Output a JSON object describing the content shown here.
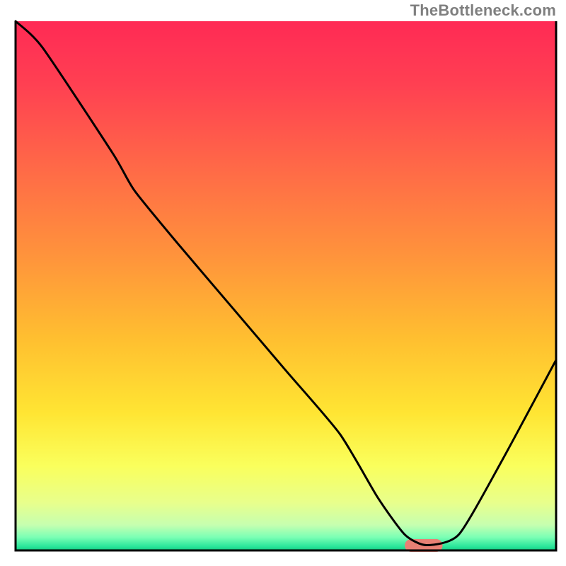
{
  "attribution": "TheBottleneck.com",
  "chart_data": {
    "type": "line",
    "title": "",
    "xlabel": "",
    "ylabel": "",
    "xlim": [
      0,
      100
    ],
    "ylim": [
      0,
      100
    ],
    "grid": false,
    "series": [
      {
        "name": "bottleneck-curve",
        "x": [
          0,
          5,
          18,
          22,
          30,
          40,
          50,
          60,
          67,
          72,
          76,
          82,
          90,
          100
        ],
        "values": [
          100,
          95,
          75,
          68,
          58,
          46,
          34,
          22,
          10,
          3,
          1,
          3,
          17,
          36
        ]
      }
    ],
    "optimal_marker": {
      "x_start": 72,
      "x_end": 79,
      "color": "#e98074",
      "thickness": 1.2
    },
    "gradient_stops": [
      {
        "offset": 0.0,
        "color": "#ff2a55"
      },
      {
        "offset": 0.12,
        "color": "#ff4052"
      },
      {
        "offset": 0.28,
        "color": "#ff6a47"
      },
      {
        "offset": 0.45,
        "color": "#ff953b"
      },
      {
        "offset": 0.6,
        "color": "#ffbf30"
      },
      {
        "offset": 0.74,
        "color": "#ffe533"
      },
      {
        "offset": 0.84,
        "color": "#faff5c"
      },
      {
        "offset": 0.91,
        "color": "#e8ff8c"
      },
      {
        "offset": 0.952,
        "color": "#c6ffb0"
      },
      {
        "offset": 0.975,
        "color": "#7bffb5"
      },
      {
        "offset": 0.993,
        "color": "#28e59a"
      },
      {
        "offset": 1.0,
        "color": "#15c77f"
      }
    ],
    "frame_color": "#000000",
    "curve_color": "#000000",
    "curve_width": 3
  }
}
